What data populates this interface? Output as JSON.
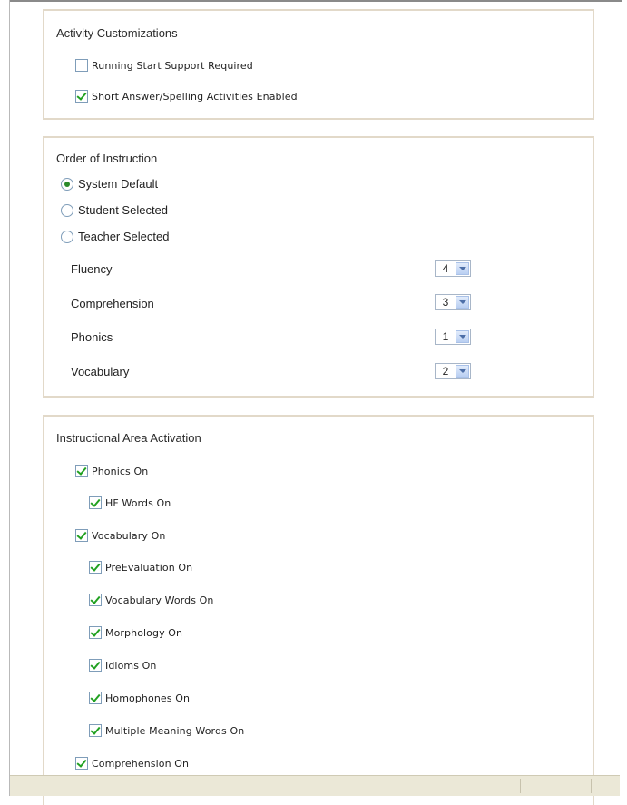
{
  "activity_customizations": {
    "title": "Activity Customizations",
    "options": [
      {
        "label": "Running Start Support Required",
        "checked": false
      },
      {
        "label": "Short Answer/Spelling Activities Enabled",
        "checked": true
      }
    ]
  },
  "order_of_instruction": {
    "title": "Order of Instruction",
    "modes": [
      {
        "label": "System Default",
        "selected": true
      },
      {
        "label": "Student Selected",
        "selected": false
      },
      {
        "label": "Teacher Selected",
        "selected": false
      }
    ],
    "areas": [
      {
        "label": "Fluency",
        "value": "4"
      },
      {
        "label": "Comprehension",
        "value": "3"
      },
      {
        "label": "Phonics",
        "value": "1"
      },
      {
        "label": "Vocabulary",
        "value": "2"
      }
    ]
  },
  "instructional_area_activation": {
    "title": "Instructional Area Activation",
    "items": [
      {
        "label": "Phonics On",
        "checked": true
      },
      {
        "label": "HF Words On",
        "checked": true
      },
      {
        "label": "Vocabulary On",
        "checked": true
      },
      {
        "label": "PreEvaluation On",
        "checked": true
      },
      {
        "label": "Vocabulary Words On",
        "checked": true
      },
      {
        "label": "Morphology On",
        "checked": true
      },
      {
        "label": "Idioms On",
        "checked": true
      },
      {
        "label": "Homophones On",
        "checked": true
      },
      {
        "label": "Multiple Meaning Words On",
        "checked": true
      },
      {
        "label": "Comprehension On",
        "checked": true
      }
    ]
  }
}
